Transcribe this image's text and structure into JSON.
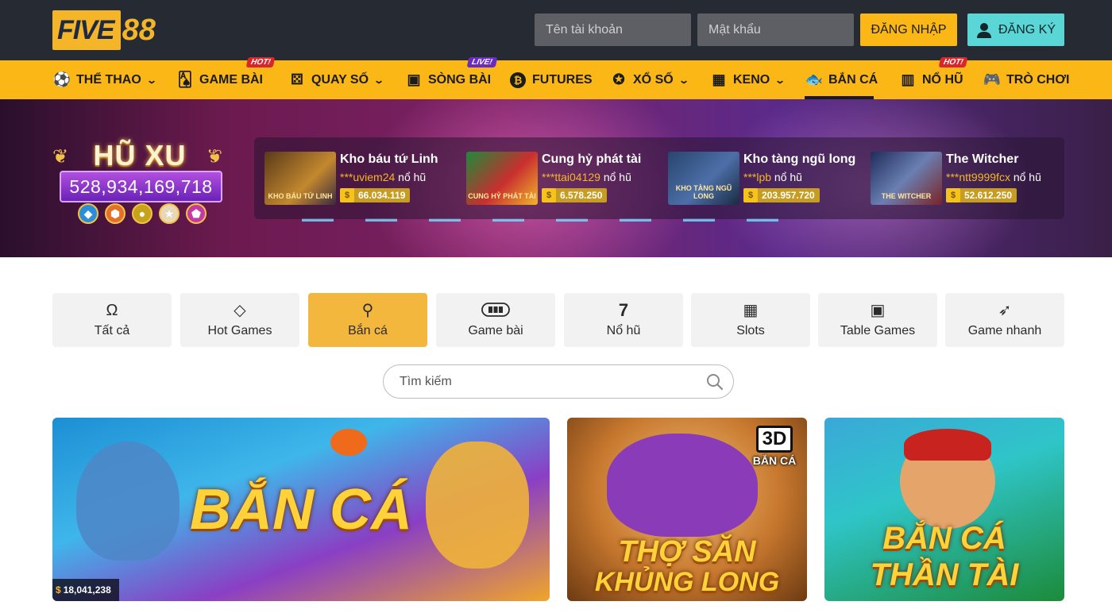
{
  "header": {
    "logo_text_a": "FIVE",
    "logo_text_b": "88",
    "username_placeholder": "Tên tài khoản",
    "password_placeholder": "Mật khẩu",
    "login_label": "ĐĂNG NHẬP",
    "register_label": "ĐĂNG KÝ"
  },
  "nav": {
    "items": [
      {
        "label": "THỂ THAO",
        "icon": "soccer-player-icon",
        "has_dropdown": true
      },
      {
        "label": "GAME BÀI",
        "icon": "playing-cards-icon",
        "badge": "HOT!"
      },
      {
        "label": "QUAY SỐ",
        "icon": "dice-icon",
        "has_dropdown": true
      },
      {
        "label": "SÒNG BÀI",
        "icon": "online-casino-icon",
        "badge": "LIVE!"
      },
      {
        "label": "FUTURES",
        "icon": "bitcoin-icon"
      },
      {
        "label": "XỔ SỐ",
        "icon": "lottery-ball-icon",
        "has_dropdown": true
      },
      {
        "label": "KENO",
        "icon": "keno-board-icon",
        "has_dropdown": true
      },
      {
        "label": "BẮN CÁ",
        "icon": "fish-icon",
        "active": true
      },
      {
        "label": "NỔ HŨ",
        "icon": "slot-machine-icon",
        "badge": "HOT!"
      },
      {
        "label": "TRÒ CHƠI",
        "icon": "gamepad-icon"
      }
    ]
  },
  "jackpot": {
    "title": "HŨ XU",
    "value": "528,934,169,718"
  },
  "winners": [
    {
      "game": "Kho báu tứ Linh",
      "user": "***uviem24",
      "suffix": "nổ hũ",
      "amount": "66.034.119",
      "thumb_text": "KHO BÁU TỨ LINH"
    },
    {
      "game": "Cung hỷ phát tài",
      "user": "***ttai04129",
      "suffix": "nổ hũ",
      "amount": "6.578.250",
      "thumb_text": "CUNG HỶ PHÁT TÀI"
    },
    {
      "game": "Kho tàng ngũ long",
      "user": "***lpb",
      "suffix": "nổ hũ",
      "amount": "203.957.720",
      "thumb_text": "KHO TÀNG NGŨ LONG"
    },
    {
      "game": "The Witcher",
      "user": "***ntt9999fcx",
      "suffix": "nổ hũ",
      "amount": "52.612.250",
      "thumb_text": "THE WITCHER"
    }
  ],
  "categories": [
    {
      "label": "Tất cả",
      "icon": "horseshoe-icon"
    },
    {
      "label": "Hot Games",
      "icon": "diamond-icon"
    },
    {
      "label": "Bắn cá",
      "icon": "fish-icon",
      "active": true
    },
    {
      "label": "Game bài",
      "icon": "cards-table-icon"
    },
    {
      "label": "Nổ hũ",
      "icon": "lucky-seven-icon"
    },
    {
      "label": "Slots",
      "icon": "slot-reels-icon"
    },
    {
      "label": "Table Games",
      "icon": "card-box-icon"
    },
    {
      "label": "Game nhanh",
      "icon": "rocket-icon"
    }
  ],
  "search": {
    "placeholder": "Tìm kiếm"
  },
  "games": [
    {
      "title": "BẮN CÁ",
      "pot": "18,041,238"
    },
    {
      "title_line1": "THỢ SĂN",
      "title_line2": "KHỦNG LONG",
      "tag_3d": "3D",
      "tag_sub": "BẮN CÁ"
    },
    {
      "title_line1": "BẮN CÁ",
      "title_line2": "THẦN TÀI"
    }
  ],
  "colors": {
    "brand_yellow": "#fbb716",
    "topbar": "#262a33",
    "register_cyan": "#5ad6d6",
    "hot_badge": "#d8262d",
    "live_badge": "#6a2bbf"
  }
}
